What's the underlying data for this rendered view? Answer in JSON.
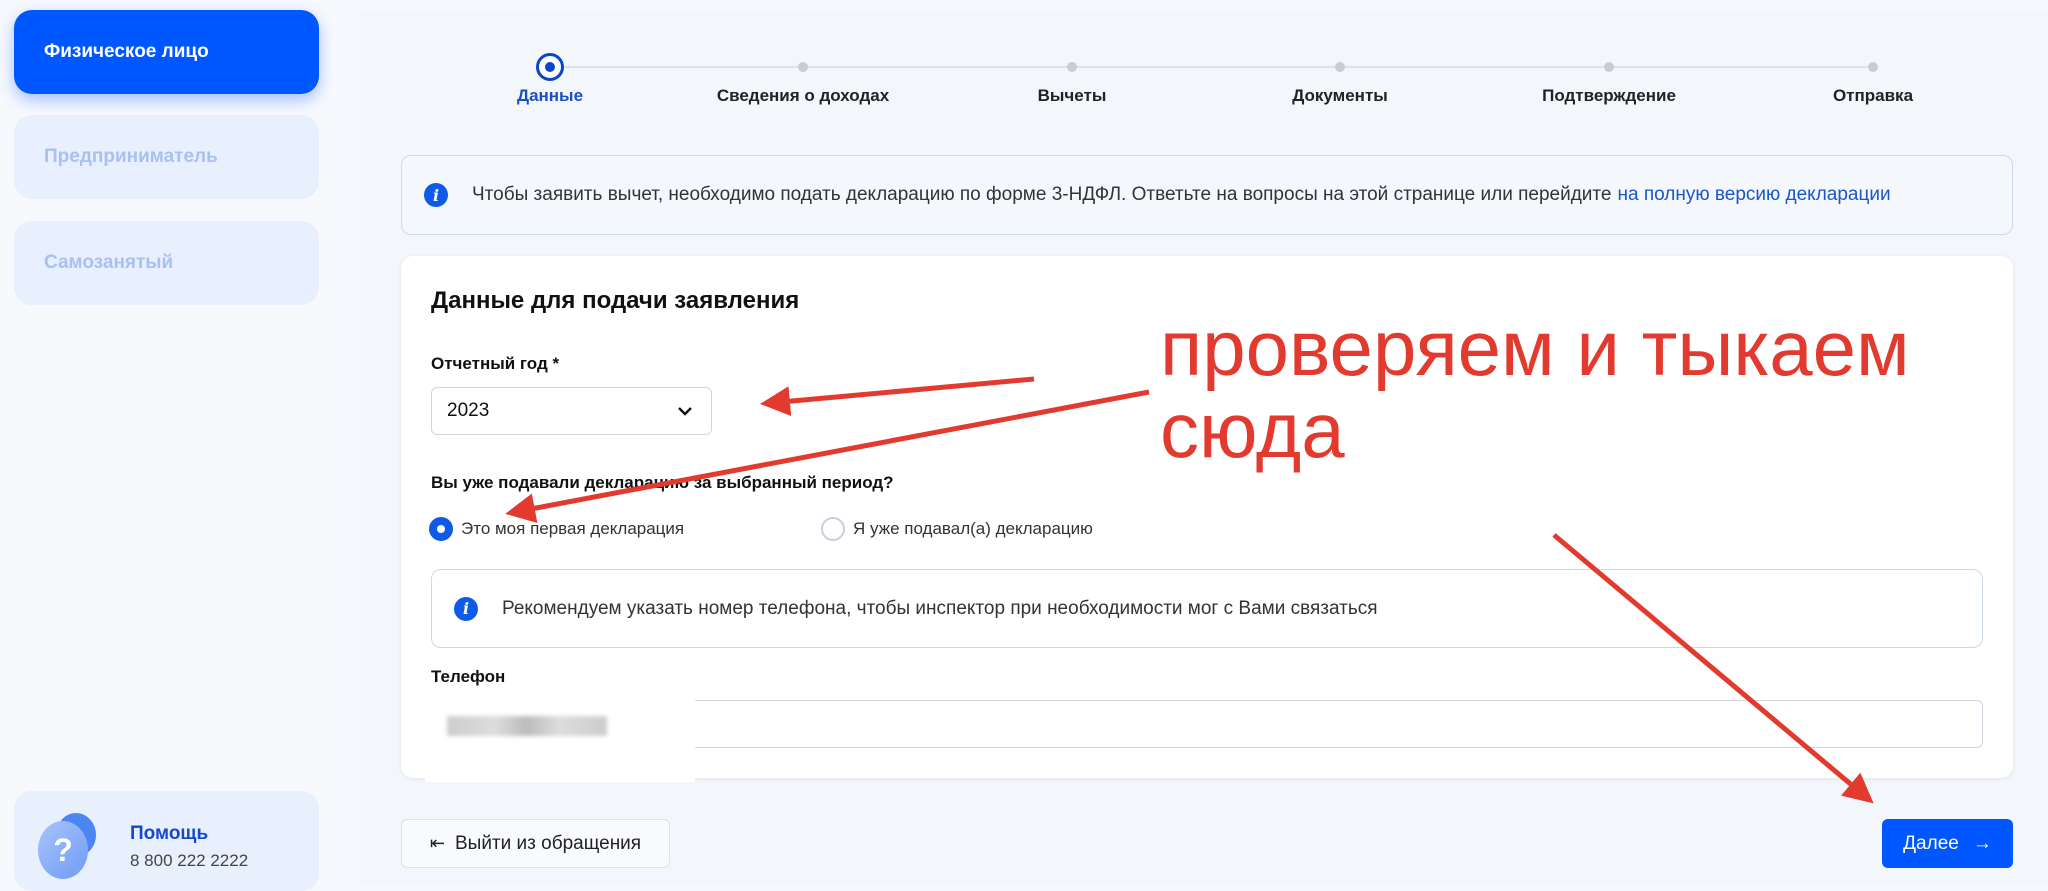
{
  "sidebar": {
    "items": [
      {
        "label": "Физическое лицо",
        "active": true
      },
      {
        "label": "Предприниматель"
      },
      {
        "label": "Самозанятый"
      }
    ],
    "help": {
      "title": "Помощь",
      "phone": "8 800 222 2222"
    }
  },
  "stepper": {
    "steps": [
      "Данные",
      "Сведения о доходах",
      "Вычеты",
      "Документы",
      "Подтверждение",
      "Отправка"
    ],
    "current": 0
  },
  "banner": {
    "text": "Чтобы заявить вычет, необходимо подать декларацию по форме 3-НДФЛ. Ответьте на вопросы на этой странице или перейдите",
    "link": "на полную версию декларации"
  },
  "form": {
    "title": "Данные для подачи заявления",
    "year_label": "Отчетный год *",
    "year_value": "2023",
    "question": "Вы уже подавали декларацию за выбранный период?",
    "options": [
      "Это моя первая декларация",
      "Я уже подавал(а) декларацию"
    ],
    "hint": "Рекомендуем указать номер телефона, чтобы инспектор при необходимости мог с Вами связаться",
    "phone_label": "Телефон"
  },
  "actions": {
    "exit": "Выйти из обращения",
    "next": "Далее"
  },
  "annotation": {
    "line1": "проверяем и тыкаем",
    "line2": "сюда",
    "color": "#e23a2e"
  }
}
